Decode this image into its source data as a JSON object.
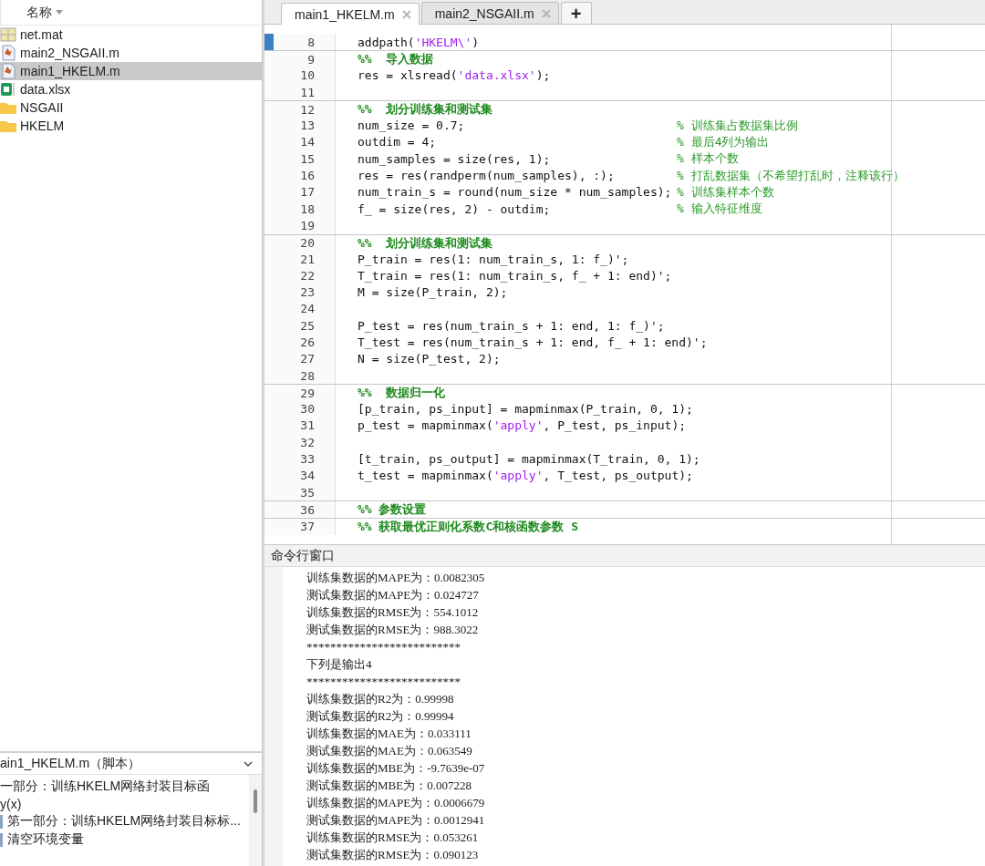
{
  "file_browser": {
    "column_header": "名称",
    "files": [
      {
        "name": "net.mat",
        "kind": "mat",
        "selected": false
      },
      {
        "name": "main2_NSGAII.m",
        "kind": "script",
        "selected": false
      },
      {
        "name": "main1_HKELM.m",
        "kind": "script",
        "selected": true
      },
      {
        "name": "data.xlsx",
        "kind": "sheet",
        "selected": false
      },
      {
        "name": "NSGAII",
        "kind": "folder",
        "selected": false
      },
      {
        "name": "HKELM",
        "kind": "folder",
        "selected": false
      }
    ]
  },
  "details": {
    "title": "ain1_HKELM.m（脚本）",
    "description": [
      "一部分：训练HKELM网络封装目标函",
      "y(x)"
    ],
    "sections": [
      "第一部分：训练HKELM网络封装目标标...",
      "清空环境变量"
    ]
  },
  "editor": {
    "tabs": [
      {
        "label": "main1_HKELM.m",
        "selected": true
      },
      {
        "label": "main2_NSGAII.m",
        "selected": false
      }
    ],
    "add_tab": "+",
    "lines": [
      {
        "num": "8",
        "current": true,
        "section": false,
        "segments": [
          {
            "kind": "code",
            "text": "addpath("
          },
          {
            "kind": "string",
            "text": "'HKELM\\'"
          },
          {
            "kind": "code",
            "text": ")"
          }
        ]
      },
      {
        "num": "9",
        "current": false,
        "section": true,
        "segments": [
          {
            "kind": "section",
            "text": "%%  导入数据"
          }
        ]
      },
      {
        "num": "10",
        "current": false,
        "section": false,
        "segments": [
          {
            "kind": "code",
            "text": "res = xlsread("
          },
          {
            "kind": "string",
            "text": "'data.xlsx'"
          },
          {
            "kind": "code",
            "text": ");"
          }
        ]
      },
      {
        "num": "11",
        "current": false,
        "section": false
      },
      {
        "num": "12",
        "current": false,
        "section": true,
        "segments": [
          {
            "kind": "section",
            "text": "%%  划分训练集和测试集"
          }
        ]
      },
      {
        "num": "13",
        "current": false,
        "section": false,
        "segments": [
          {
            "kind": "code",
            "text": "num_size = 0.7;"
          }
        ],
        "comment": "% 训练集占数据集比例"
      },
      {
        "num": "14",
        "current": false,
        "section": false,
        "segments": [
          {
            "kind": "code",
            "text": "outdim = 4;"
          }
        ],
        "comment": "% 最后4列为输出"
      },
      {
        "num": "15",
        "current": false,
        "section": false,
        "segments": [
          {
            "kind": "code",
            "text": "num_samples = size(res, 1);"
          }
        ],
        "comment": "% 样本个数"
      },
      {
        "num": "16",
        "current": false,
        "section": false,
        "segments": [
          {
            "kind": "code",
            "text": "res = res(randperm(num_samples), :);"
          }
        ],
        "comment": "% 打乱数据集（不希望打乱时，注释该行）"
      },
      {
        "num": "17",
        "current": false,
        "section": false,
        "segments": [
          {
            "kind": "code",
            "text": "num_train_s = round(num_size * num_samples);"
          }
        ],
        "comment": "% 训练集样本个数"
      },
      {
        "num": "18",
        "current": false,
        "section": false,
        "segments": [
          {
            "kind": "code",
            "text": "f_ = size(res, 2) - outdim;"
          }
        ],
        "comment": "% 输入特征维度"
      },
      {
        "num": "19",
        "current": false,
        "section": false
      },
      {
        "num": "20",
        "current": false,
        "section": true,
        "segments": [
          {
            "kind": "section",
            "text": "%%  划分训练集和测试集"
          }
        ]
      },
      {
        "num": "21",
        "current": false,
        "section": false,
        "segments": [
          {
            "kind": "code",
            "text": "P_train = res(1: num_train_s, 1: f_)';"
          }
        ]
      },
      {
        "num": "22",
        "current": false,
        "section": false,
        "segments": [
          {
            "kind": "code",
            "text": "T_train = res(1: num_train_s, f_ + 1: end)';"
          }
        ]
      },
      {
        "num": "23",
        "current": false,
        "section": false,
        "segments": [
          {
            "kind": "code",
            "text": "M = size(P_train, 2);"
          }
        ]
      },
      {
        "num": "24",
        "current": false,
        "section": false
      },
      {
        "num": "25",
        "current": false,
        "section": false,
        "segments": [
          {
            "kind": "code",
            "text": "P_test = res(num_train_s + 1: end, 1: f_)';"
          }
        ]
      },
      {
        "num": "26",
        "current": false,
        "section": false,
        "segments": [
          {
            "kind": "code",
            "text": "T_test = res(num_train_s + 1: end, f_ + 1: end)';"
          }
        ]
      },
      {
        "num": "27",
        "current": false,
        "section": false,
        "segments": [
          {
            "kind": "code",
            "text": "N = size(P_test, 2);"
          }
        ]
      },
      {
        "num": "28",
        "current": false,
        "section": false
      },
      {
        "num": "29",
        "current": false,
        "section": true,
        "segments": [
          {
            "kind": "section",
            "text": "%%  数据归一化"
          }
        ]
      },
      {
        "num": "30",
        "current": false,
        "section": false,
        "segments": [
          {
            "kind": "code",
            "text": "[p_train, ps_input] = mapminmax(P_train, 0, 1);"
          }
        ]
      },
      {
        "num": "31",
        "current": false,
        "section": false,
        "segments": [
          {
            "kind": "code",
            "text": "p_test = mapminmax("
          },
          {
            "kind": "string",
            "text": "'apply'"
          },
          {
            "kind": "code",
            "text": ", P_test, ps_input);"
          }
        ]
      },
      {
        "num": "32",
        "current": false,
        "section": false
      },
      {
        "num": "33",
        "current": false,
        "section": false,
        "segments": [
          {
            "kind": "code",
            "text": "[t_train, ps_output] = mapminmax(T_train, 0, 1);"
          }
        ]
      },
      {
        "num": "34",
        "current": false,
        "section": false,
        "segments": [
          {
            "kind": "code",
            "text": "t_test = mapminmax("
          },
          {
            "kind": "string",
            "text": "'apply'"
          },
          {
            "kind": "code",
            "text": ", T_test, ps_output);"
          }
        ]
      },
      {
        "num": "35",
        "current": false,
        "section": false
      },
      {
        "num": "36",
        "current": false,
        "section": true,
        "segments": [
          {
            "kind": "section",
            "text": "%% 参数设置"
          }
        ]
      },
      {
        "num": "37",
        "current": false,
        "section": true,
        "segments": [
          {
            "kind": "section",
            "text": "%% 获取最优正则化系数C和核函数参数 S"
          }
        ]
      }
    ]
  },
  "console": {
    "title": "命令行窗口",
    "lines": [
      "训练集数据的MAPE为：0.0082305",
      "测试集数据的MAPE为：0.024727",
      "训练集数据的RMSE为：554.1012",
      "测试集数据的RMSE为：988.3022",
      "**************************",
      "下列是输出4",
      "**************************",
      "训练集数据的R2为：0.99998",
      "测试集数据的R2为：0.99994",
      "训练集数据的MAE为：0.033111",
      "测试集数据的MAE为：0.063549",
      "训练集数据的MBE为：-9.7639e-07",
      "测试集数据的MBE为：0.007228",
      "训练集数据的MAPE为：0.0006679",
      "测试集数据的MAPE为：0.0012941",
      "训练集数据的RMSE为：0.053261",
      "测试集数据的RMSE为：0.090123"
    ]
  }
}
